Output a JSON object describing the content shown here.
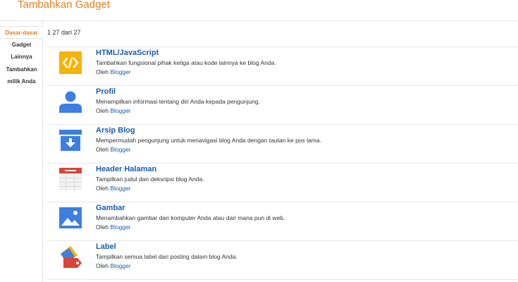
{
  "header": {
    "title": "Tambahkan Gadget"
  },
  "sidebar": {
    "items": [
      {
        "label": "Dasar-dasar",
        "active": true
      },
      {
        "label": "Gadget",
        "active": false
      },
      {
        "label": "Lainnya",
        "active": false
      },
      {
        "label": "Tambahkan",
        "active": false
      },
      {
        "label": "milik Anda",
        "active": false
      }
    ]
  },
  "main": {
    "count_text": "1 27 dari 27",
    "by_prefix": "Oleh",
    "gadgets": [
      {
        "title": "HTML/JavaScript",
        "description": "Tambahkan fungsional pihak ketiga atau kode lainnya ke blog Anda.",
        "author": "Blogger",
        "icon": "code-icon"
      },
      {
        "title": "Profil",
        "description": "Menampilkan informasi tentang diri Anda kepada pengunjung.",
        "author": "Blogger",
        "icon": "person-icon"
      },
      {
        "title": "Arsip Blog",
        "description": "Mempermudah pengunjung untuk menavigasi blog Anda dengan tautan ke pos lama.",
        "author": "Blogger",
        "icon": "archive-icon"
      },
      {
        "title": "Header Halaman",
        "description": "Tampilkan judul dan deksripsi blog Anda.",
        "author": "Blogger",
        "icon": "page-header-icon"
      },
      {
        "title": "Gambar",
        "description": "Menambahkan gambar dari komputer Anda atau dari mana pun di web.",
        "author": "Blogger",
        "icon": "image-icon"
      },
      {
        "title": "Label",
        "description": "Tampilkan semua label dari posting dalam blog Anda.",
        "author": "Blogger",
        "icon": "label-icon"
      }
    ]
  },
  "colors": {
    "accent": "#e67e22",
    "link": "#1a5cb0",
    "icon_blue": "#3d7fe0",
    "icon_yellow": "#f5b400",
    "icon_red": "#db4437"
  }
}
